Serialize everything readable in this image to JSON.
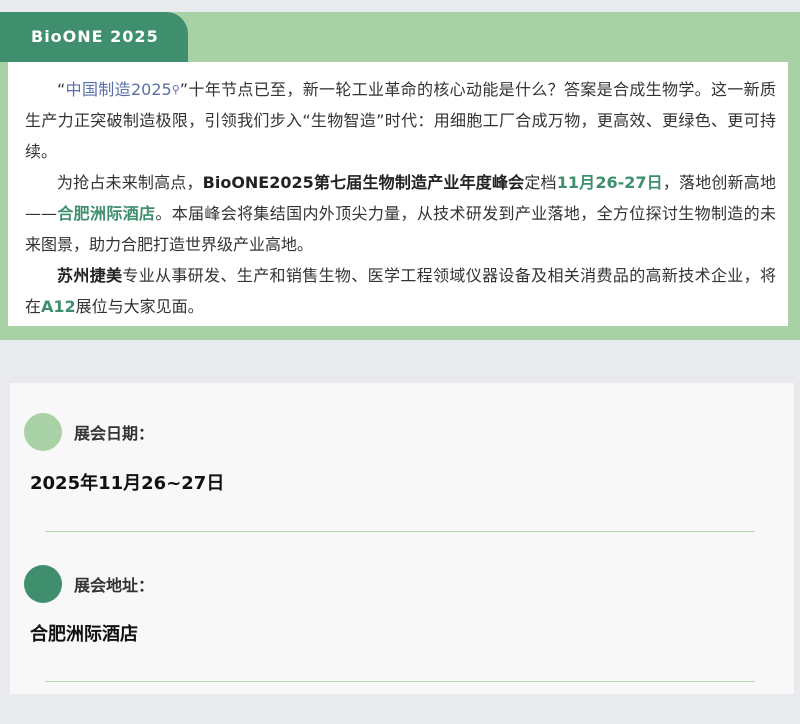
{
  "intro": {
    "tab_title": "BioONE 2025",
    "p1": {
      "open_quote": "“",
      "link_text": "中国制造2025",
      "close_text": "”十年节点已至，新一轮工业革命的核心动能是什么？答案是合成生物学。这一新质生产力正突破制造极限，引领我们步入“生物智造”时代：用细胞工厂合成万物，更高效、更绿色、更可持续。"
    },
    "p2": {
      "t1": "为抢占未来制高点，",
      "event_name": "BioONE2025第七届生物制造产业年度峰会",
      "t2": "定档",
      "dates": "11月26-27日",
      "t3": "，落地创新高地——",
      "venue": "合肥洲际酒店",
      "t4": "。本届峰会将集结国内外顶尖力量，从技术研发到产业落地，全方位探讨生物制造的未来图景，助力合肥打造世界级产业高地。"
    },
    "p3": {
      "company": "苏州捷美",
      "t1": "专业从事研发、生产和销售生物、医学工程领域仪器设备及相关消费品的高新技术企业，将在",
      "booth": "A12",
      "t2": "展位与大家见面。"
    }
  },
  "info": {
    "date_label": "展会日期：",
    "date_value": "2025年11月26~27日",
    "address_label": "展会地址：",
    "address_value": "合肥洲际酒店"
  },
  "colors": {
    "accent_dark": "#3f8f6e",
    "accent_light": "#a9d1a6",
    "link": "#5a6fa8"
  },
  "icons": {
    "search": "magnifier-icon"
  }
}
